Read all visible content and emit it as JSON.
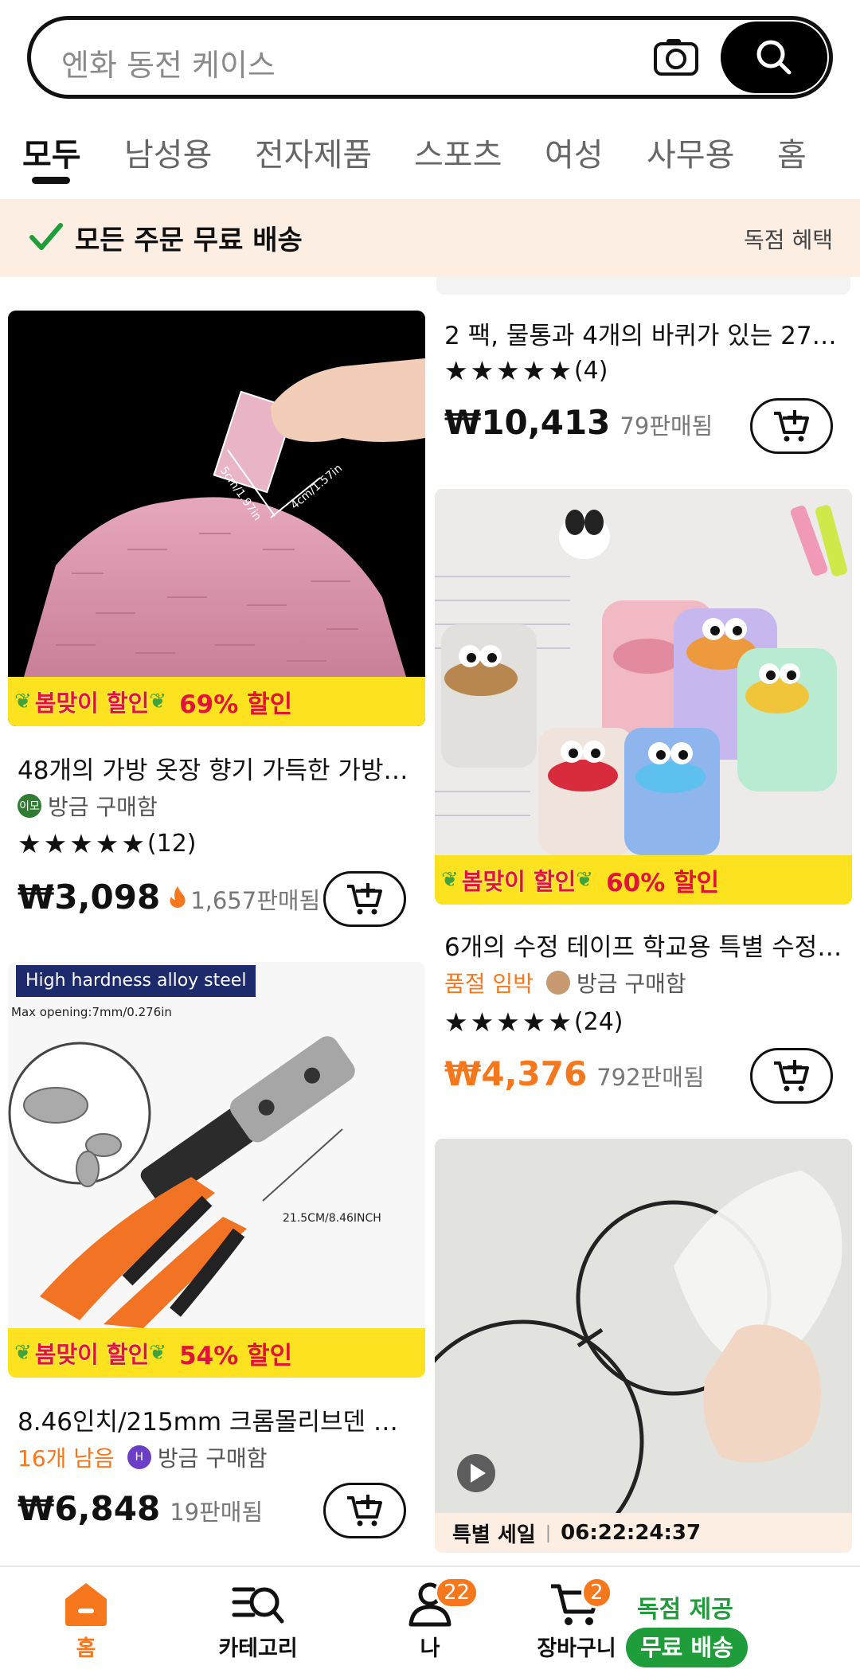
{
  "search": {
    "placeholder": "엔화 동전 케이스",
    "camera_icon": "camera-icon",
    "search_icon": "search-icon"
  },
  "tabs": [
    {
      "label": "모두",
      "active": true
    },
    {
      "label": "남성용"
    },
    {
      "label": "전자제품"
    },
    {
      "label": "스포츠"
    },
    {
      "label": "여성"
    },
    {
      "label": "사무용"
    },
    {
      "label": "홈"
    }
  ],
  "banner": {
    "text": "모든 주문 무료 배송",
    "right_label": "독점 혜택"
  },
  "products": {
    "p1": {
      "promo_tag": "봄맞이 할인",
      "promo_pct": "69% 할인",
      "title": "48개의 가방 옷장 향기 가득한 가방, ...",
      "avatar_text": "이모",
      "activity": "방금 구매함",
      "stars": "★★★★★",
      "reviews": "(12)",
      "price": "₩3,098",
      "sold_count": "1,657",
      "sold_label": "판매됨",
      "image_text": {
        "size1": "5cm/1.97in",
        "size2": "4cm/1.57in"
      }
    },
    "p2": {
      "title": "2 팩, 물통과 4개의 바퀴가 있는 27....",
      "stars": "★★★★★",
      "reviews": "(4)",
      "price": "₩10,413",
      "sold_count": "79",
      "sold_label": "판매됨"
    },
    "p3": {
      "promo_tag": "봄맞이 할인",
      "promo_pct": "60% 할인",
      "title": "6개의 수정 테이프 학교용 특별 수정 ...",
      "urgency": "품절 임박",
      "activity": "방금 구매함",
      "stars": "★★★★★",
      "reviews": "(24)",
      "price": "₩4,376",
      "sold_count": "792",
      "sold_label": "판매됨"
    },
    "p4": {
      "image_caption": "High hardness alloy steel",
      "max_opening": "Max opening:7mm/0.276in",
      "dimension": "21.5CM/8.46INCH",
      "promo_tag": "봄맞이 할인",
      "promo_pct": "54% 할인",
      "title": "8.46인치/215mm 크롬몰리브덴 강...",
      "urgency": "16개 남음",
      "avatar_text": "H",
      "activity": "방금 구매함",
      "price": "₩6,848",
      "sold_count": "19",
      "sold_label": "판매됨"
    },
    "p5": {
      "sale_label": "특별 세일",
      "countdown": "06:22:24:37"
    }
  },
  "nav": {
    "home": {
      "label": "홈",
      "icon": "home-icon"
    },
    "category": {
      "label": "카테고리",
      "icon": "category-search-icon"
    },
    "me": {
      "label": "나",
      "badge": "22",
      "icon": "person-icon"
    },
    "cart": {
      "label": "장바구니",
      "badge": "2",
      "icon": "cart-icon"
    },
    "promo_top": "독점 제공",
    "promo_pill": "무료 배송"
  },
  "colors": {
    "accent_orange": "#f7771c",
    "sale_red": "#e1123b",
    "promo_yellow": "#fde21f",
    "green": "#1f9d3a",
    "banner_bg": "#fdeee3"
  }
}
